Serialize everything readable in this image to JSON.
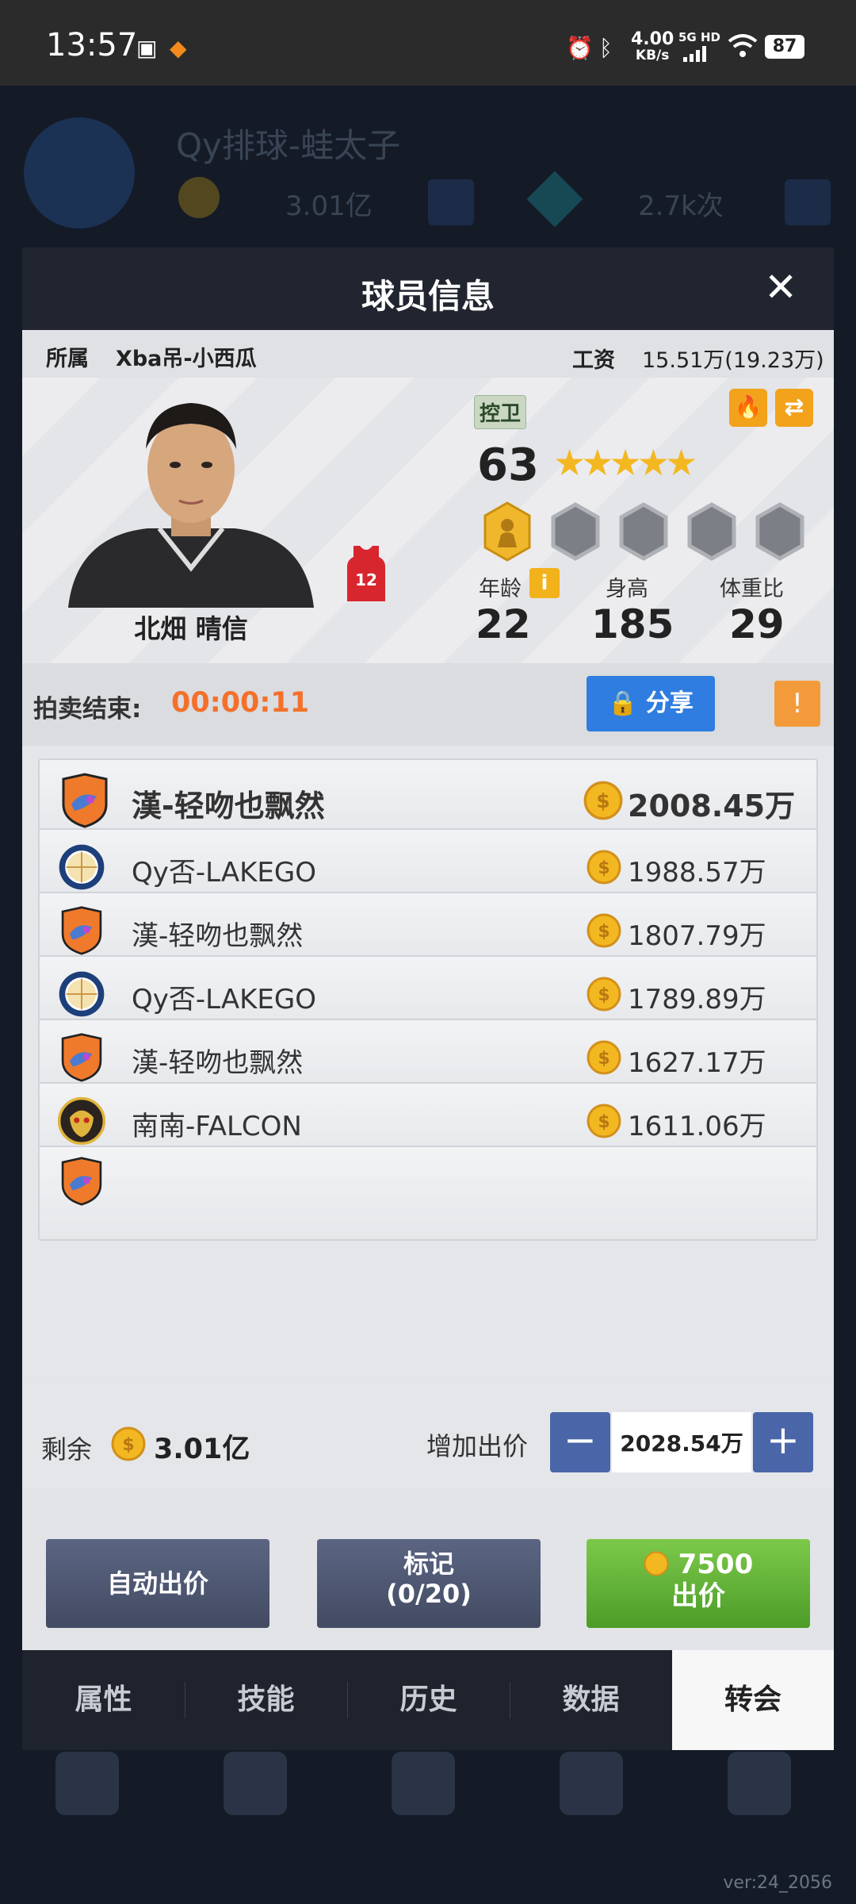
{
  "status_bar": {
    "time": "13:57",
    "net_speed": "4.00",
    "net_unit": "KB/s",
    "network": "5G HD",
    "battery": "87"
  },
  "background_app": {
    "team_name": "Qy排球-蛙太子",
    "money": "3.01亿",
    "diamonds": "2.7k次",
    "version": "ver:24_2056"
  },
  "modal": {
    "title": "球员信息",
    "close_label": "✕",
    "belong_label": "所属",
    "belong_value": "Xba吊-小西瓜",
    "salary_label": "工资",
    "salary_value": "15.51万(19.23万)"
  },
  "player": {
    "name": "北畑 晴信",
    "jersey_number": "12",
    "position": "控卫",
    "overall": "63",
    "stars_full": 5,
    "stars_shown": "★★★★★",
    "age_label": "年龄",
    "age": "22",
    "height_label": "身高",
    "height": "185",
    "weight_ratio_label": "体重比",
    "weight_ratio": "29",
    "info_icon_label": "i"
  },
  "auction": {
    "end_label": "拍卖结束:",
    "timer": "00:00:11",
    "share_label": "分享",
    "warn_label": "!"
  },
  "bids": [
    {
      "team": "漢-轻吻也飘然",
      "amount": "2008.45万",
      "logo": "orange-shield",
      "highlight": true
    },
    {
      "team": "Qy否-LAKEGO",
      "amount": "1988.57万",
      "logo": "blue-ball",
      "highlight": false
    },
    {
      "team": "漢-轻吻也飘然",
      "amount": "1807.79万",
      "logo": "orange-shield",
      "highlight": false
    },
    {
      "team": "Qy否-LAKEGO",
      "amount": "1789.89万",
      "logo": "blue-ball",
      "highlight": false
    },
    {
      "team": "漢-轻吻也飘然",
      "amount": "1627.17万",
      "logo": "orange-shield",
      "highlight": false
    },
    {
      "team": "南南-FALCON",
      "amount": "1611.06万",
      "logo": "gold-beast",
      "highlight": false
    }
  ],
  "bottom": {
    "remain_label": "剩余",
    "remain_value": "3.01亿",
    "raise_label": "增加出价",
    "raise_value": "2028.54万",
    "minus_label": "−",
    "plus_label": "+"
  },
  "actions": {
    "auto_bid": "自动出价",
    "mark_line1": "标记",
    "mark_line2": "(0/20)",
    "bid_cost": "7500",
    "bid_label": "出价"
  },
  "tabs": [
    "属性",
    "技能",
    "历史",
    "数据",
    "转会"
  ],
  "active_tab": "转会",
  "colors": {
    "accent_orange": "#f4702a",
    "share_blue": "#2f7de0",
    "bid_green": "#5fb333",
    "coin_gold": "#f3b821"
  }
}
